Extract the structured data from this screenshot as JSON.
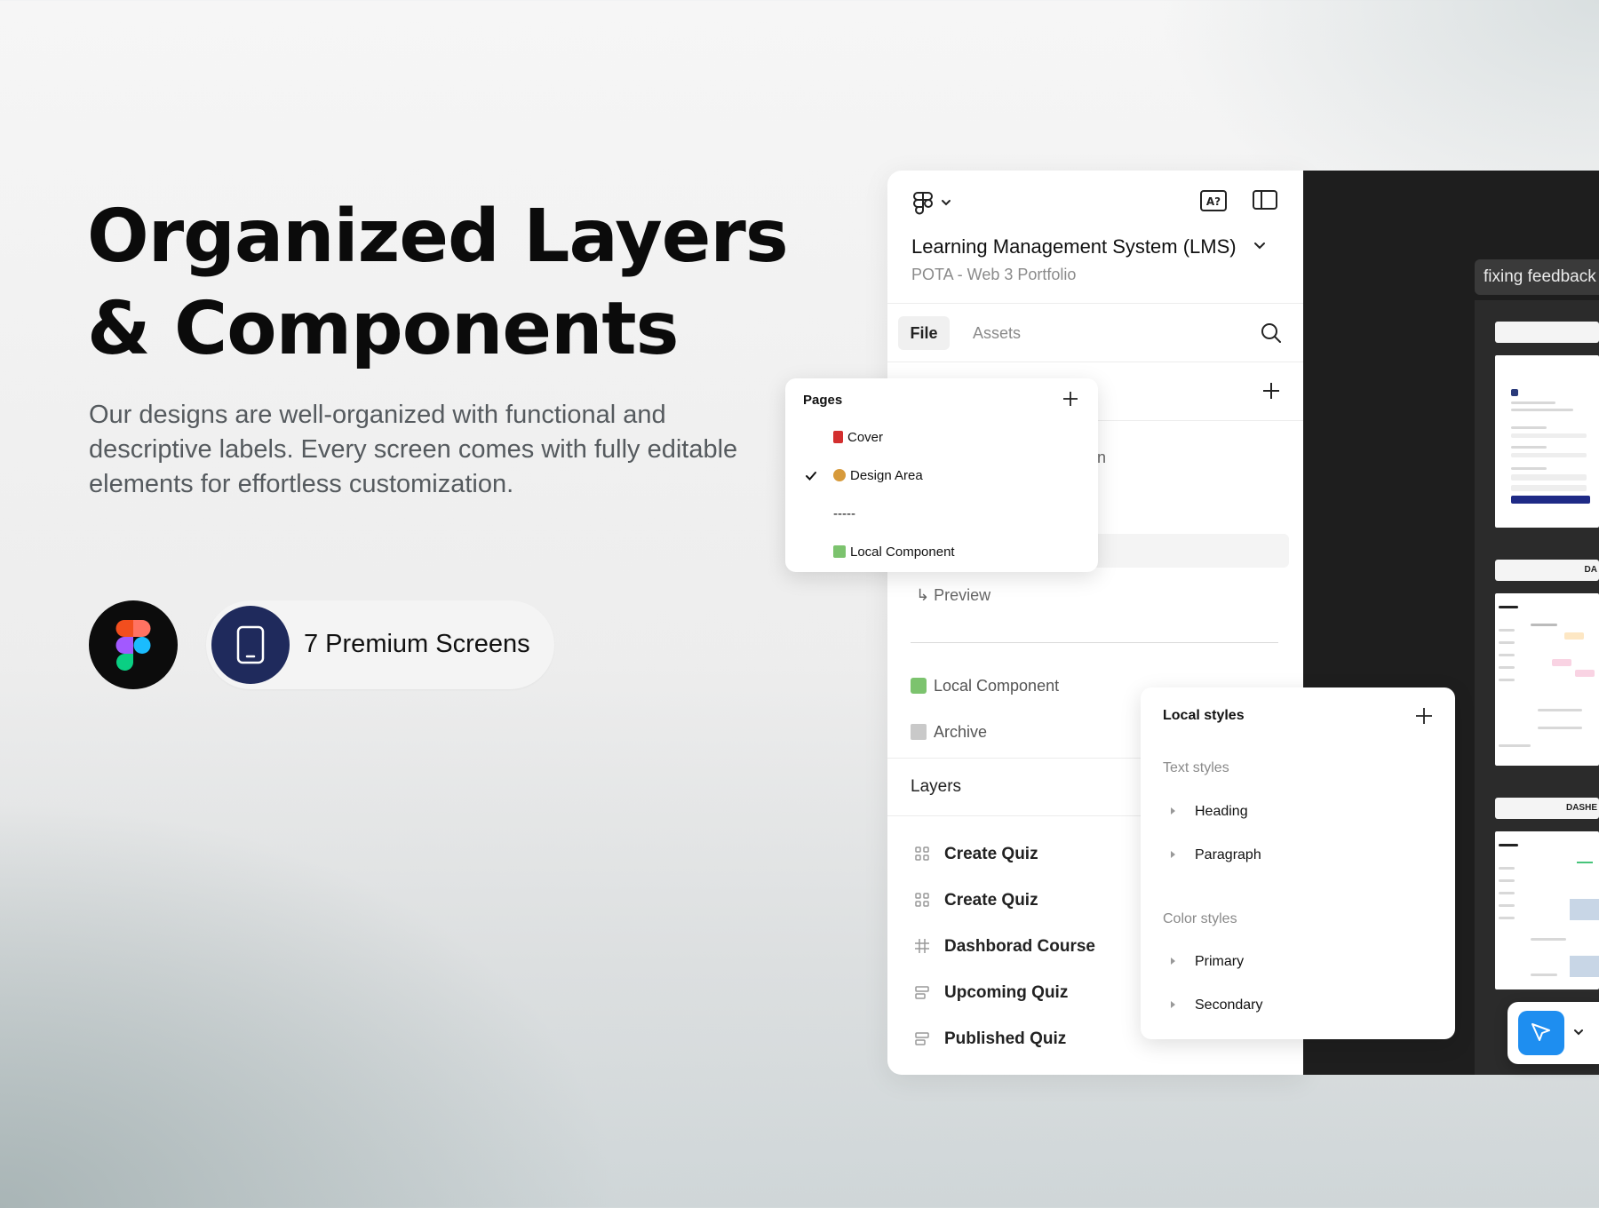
{
  "hero": {
    "title_line1": "Organized Layers",
    "title_line2": "& Components",
    "description": "Our designs are well-organized with functional and descriptive labels. Every screen comes with fully editable elements for effortless customization.",
    "badge_label": "7 Premium Screens"
  },
  "panel": {
    "project_title": "Learning Management System (LMS)",
    "project_subtitle": "POTA - Web 3 Portfolio",
    "tabs": [
      {
        "label": "File",
        "active": true
      },
      {
        "label": "Assets",
        "active": false
      }
    ],
    "partial_page_text": "n",
    "preview_label": "↳ Preview",
    "local_component_label": "Local Component",
    "archive_label": "Archive",
    "layers_title": "Layers",
    "layers": [
      {
        "label": "Create Quiz",
        "icon": "component-icon"
      },
      {
        "label": "Create Quiz",
        "icon": "component-icon"
      },
      {
        "label": "Dashborad Course",
        "icon": "frame-hash-icon"
      },
      {
        "label": "Upcoming Quiz",
        "icon": "auto-layout-icon"
      },
      {
        "label": "Published Quiz",
        "icon": "auto-layout-icon"
      }
    ]
  },
  "pages_popover": {
    "title": "Pages",
    "items": [
      {
        "label": "Cover",
        "emoji": "red-book",
        "color": "#d32f2f",
        "selected": false
      },
      {
        "label": "Design Area",
        "emoji": "palette",
        "color": "#d79a3b",
        "selected": true
      },
      {
        "label": "-----",
        "emoji": "",
        "selected": false
      },
      {
        "label": "Local Component",
        "emoji": "puzzle",
        "color": "#7cc36e",
        "selected": false
      }
    ]
  },
  "styles_popover": {
    "title": "Local styles",
    "text_styles_label": "Text styles",
    "text_styles": [
      "Heading",
      "Paragraph"
    ],
    "color_styles_label": "Color styles",
    "color_styles": [
      "Primary",
      "Secondary"
    ]
  },
  "canvas": {
    "feedback_chip": "fixing feedback",
    "frame_labels": [
      "",
      "DA",
      "DASHE"
    ],
    "accent_color": "#1e8ef0",
    "background": "#1e1e1e"
  },
  "colors": {
    "badge_navy": "#1f2a5c",
    "figma_red": "#f24e1e",
    "figma_orange": "#ff7262",
    "figma_purple": "#a259ff",
    "figma_blue": "#1abcfe",
    "figma_green": "#0acf83"
  }
}
